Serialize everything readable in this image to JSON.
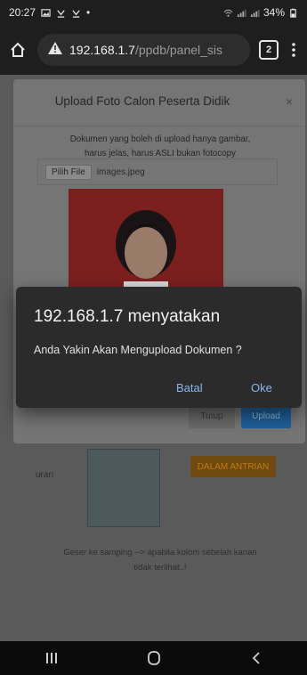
{
  "status_bar": {
    "time": "20:27",
    "dot": "•",
    "battery": "34%"
  },
  "browser": {
    "url_host": "192.168.1.7",
    "url_path": "/ppdb/panel_sis",
    "tab_count": "2"
  },
  "modal": {
    "title": "Upload Foto Calon Peserta Didik",
    "close": "×",
    "description_line1": "Dokumen yang boleh di upload hanya gambar,",
    "description_line2": "harus jelas, harus ASLI bukan fotocopy",
    "file_button": "Pilih File",
    "file_name": "images.jpeg",
    "close_button": "Tutup",
    "upload_button": "Upload"
  },
  "background": {
    "status_badge": "DALAM ANTRIAN",
    "row_label": "uran",
    "note_line1": "Geser ke samping --> apabila kolom sebelah kanan",
    "note_line2": "tidak terlihat..!"
  },
  "dialog": {
    "title": "192.168.1.7 menyatakan",
    "message": "Anda Yakin Akan Mengupload Dokumen ?",
    "cancel": "Batal",
    "ok": "Oke"
  },
  "colors": {
    "accent": "#86b4f0",
    "photo_bg": "#7b1f1f",
    "upload_btn": "#1e5f9a"
  }
}
